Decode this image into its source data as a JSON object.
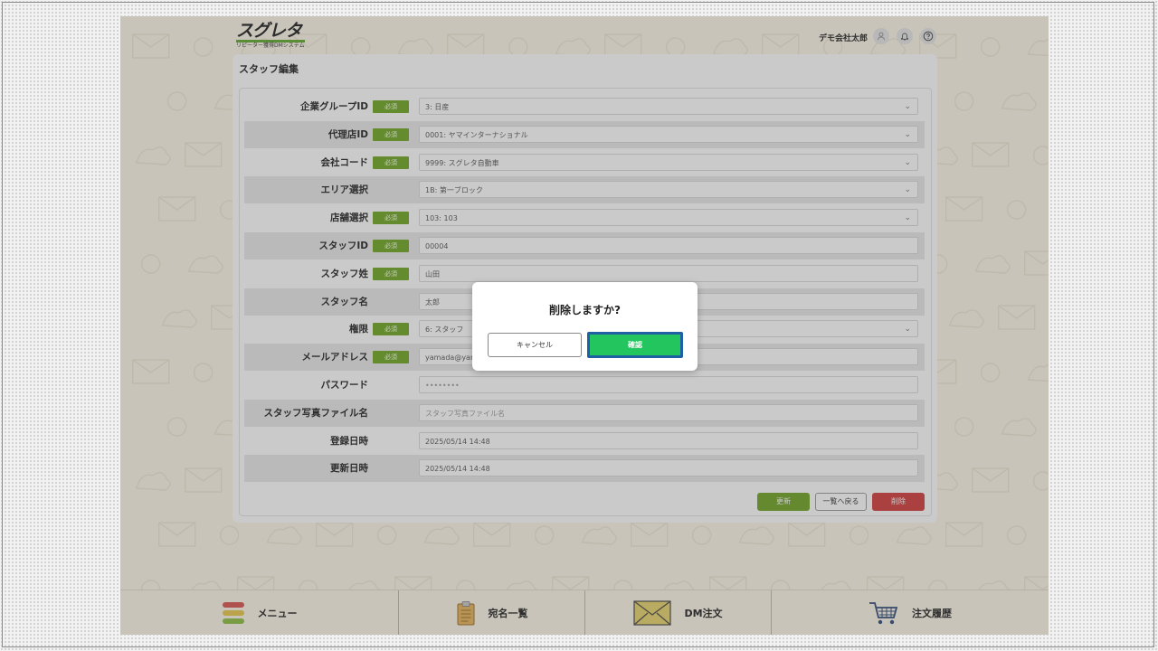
{
  "header": {
    "logo_main": "スグレタ",
    "logo_sub": "リピーター獲得DMシステム",
    "user_name": "デモ会社太郎",
    "user_icon": "user-icon",
    "bell_icon": "bell-icon",
    "help_icon": "help-icon"
  },
  "page": {
    "title": "スタッフ編集"
  },
  "form": {
    "required_badge": "必須",
    "rows": [
      {
        "label": "企業グループID",
        "value": "3: 日産",
        "required": true,
        "dropdown": true
      },
      {
        "label": "代理店ID",
        "value": "0001: ヤマインターナショナル",
        "required": true,
        "dropdown": true
      },
      {
        "label": "会社コード",
        "value": "9999: スグレタ自動車",
        "required": true,
        "dropdown": true
      },
      {
        "label": "エリア選択",
        "value": "1B: 第一ブロック",
        "required": false,
        "dropdown": true
      },
      {
        "label": "店舗選択",
        "value": "103: 103",
        "required": true,
        "dropdown": true
      },
      {
        "label": "スタッフID",
        "value": "00004",
        "required": true,
        "dropdown": false
      },
      {
        "label": "スタッフ姓",
        "value": "山田",
        "required": true,
        "dropdown": false
      },
      {
        "label": "スタッフ名",
        "value": "太郎",
        "required": false,
        "dropdown": false
      },
      {
        "label": "権限",
        "value": "6: スタッフ",
        "required": true,
        "dropdown": true
      },
      {
        "label": "メールアドレス",
        "value": "yamada@yam",
        "required": true,
        "dropdown": false
      },
      {
        "label": "パスワード",
        "value": "••••••••",
        "required": false,
        "dropdown": false,
        "placeholder_style": true
      },
      {
        "label": "スタッフ写真ファイル名",
        "value": "スタッフ写真ファイル名",
        "required": false,
        "dropdown": false,
        "placeholder_style": true
      },
      {
        "label": "登録日時",
        "value": "2025/05/14 14:48",
        "required": false,
        "dropdown": false
      },
      {
        "label": "更新日時",
        "value": "2025/05/14 14:48",
        "required": false,
        "dropdown": false
      }
    ]
  },
  "actions": {
    "update": "更新",
    "back": "一覧へ戻る",
    "delete": "削除"
  },
  "bottom_nav": [
    {
      "label": "メニュー",
      "icon": "menu-icon"
    },
    {
      "label": "宛名一覧",
      "icon": "clipboard-icon"
    },
    {
      "label": "DM注文",
      "icon": "envelope-icon"
    },
    {
      "label": "注文履歴",
      "icon": "cart-icon"
    }
  ],
  "dialog": {
    "title": "削除しますか?",
    "cancel": "キャンセル",
    "confirm": "確認"
  },
  "colors": {
    "required_green": "#6da620",
    "update_green": "#6ea321",
    "delete_red": "#d13a3a",
    "confirm_green": "#22c55e",
    "confirm_border": "#1f5fa3",
    "app_background": "#fcf6e9"
  }
}
